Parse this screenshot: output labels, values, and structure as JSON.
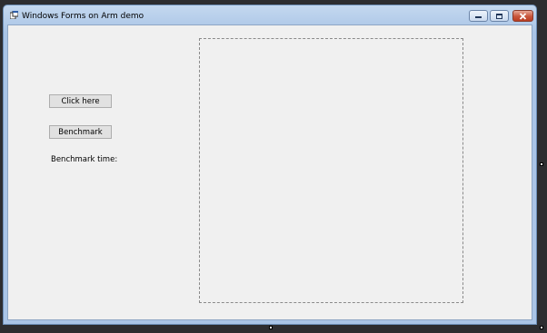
{
  "window": {
    "title": "Windows Forms on Arm demo",
    "icon": "app-icon"
  },
  "caption_buttons": {
    "minimize_icon": "minimize-icon",
    "maximize_icon": "maximize-icon",
    "close_icon": "close-icon"
  },
  "form": {
    "click_button_label": "Click here",
    "benchmark_button_label": "Benchmark",
    "benchmark_time_label": "Benchmark time:"
  },
  "colors": {
    "title_gradient_top": "#c4d8ef",
    "client_background": "#f0f0f0",
    "close_button": "#c8553b"
  }
}
